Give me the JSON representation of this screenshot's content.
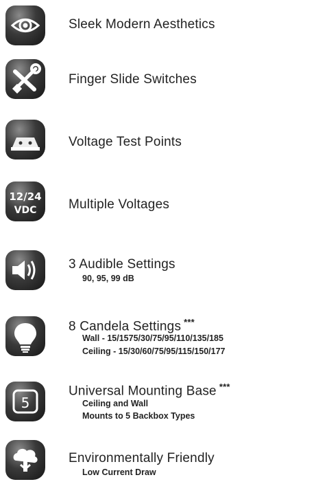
{
  "features": [
    {
      "title": "Sleek Modern Aesthetics",
      "icon": "eye-icon"
    },
    {
      "title": "Finger Slide Switches",
      "icon": "tools-icon"
    },
    {
      "title": "Voltage Test Points",
      "icon": "test-points-icon"
    },
    {
      "title": "Multiple Voltages",
      "icon": "voltage-icon",
      "icon_text_top": "12/24",
      "icon_text_bottom": "VDC"
    },
    {
      "title": "3 Audible Settings",
      "icon": "speaker-icon",
      "details": [
        "90, 95, 99 dB"
      ]
    },
    {
      "title": "8 Candela Settings",
      "stars": "***",
      "icon": "lightbulb-icon",
      "details": [
        "Wall - 15/1575/30/75/95/110/135/185",
        "Ceiling - 15/30/60/75/95/115/150/177"
      ]
    },
    {
      "title": "Universal Mounting Base",
      "stars": "***",
      "icon": "mounting-base-icon",
      "icon_text": "5",
      "details": [
        "Ceiling and Wall",
        "Mounts to 5 Backbox Types"
      ]
    },
    {
      "title": "Environmentally Friendly",
      "icon": "eco-icon",
      "details": [
        "Low Current Draw"
      ]
    }
  ]
}
